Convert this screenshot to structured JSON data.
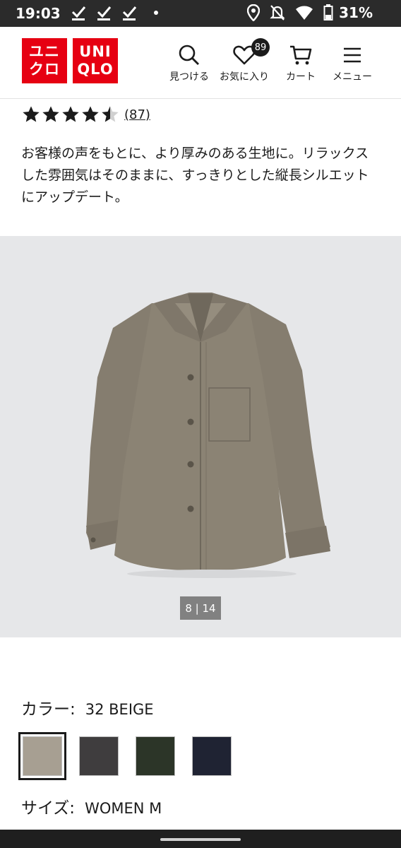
{
  "status_bar": {
    "time": "19:03",
    "battery": "31%",
    "icons": [
      "check-icon",
      "check-icon",
      "check-icon",
      "dot-icon",
      "location-icon",
      "mute-icon",
      "wifi-icon",
      "battery-icon"
    ]
  },
  "header": {
    "logo": {
      "left_top": "ユニ",
      "left_bottom": "クロ",
      "right_top": "UNI",
      "right_bottom": "QLO"
    },
    "nav": {
      "search": "見つける",
      "favorites": "お気に入り",
      "favorites_badge": "89",
      "cart": "カート",
      "menu": "メニュー"
    }
  },
  "product": {
    "rating": 4.5,
    "review_count": "(87)",
    "description": "お客様の声をもとに、より厚みのある生地に。リラックスした雰囲気はそのままに、すっきりとした縦長シルエットにアップデート。",
    "image_counter": "8 | 14",
    "color_label": "カラー:",
    "color_value": "32 BEIGE",
    "swatches": [
      {
        "name": "beige",
        "color": "#a79f92",
        "selected": true
      },
      {
        "name": "dark-gray",
        "color": "#3f3d3e",
        "selected": false
      },
      {
        "name": "olive",
        "color": "#2c3528",
        "selected": false
      },
      {
        "name": "navy",
        "color": "#1f2333",
        "selected": false
      }
    ],
    "size_label": "サイズ:",
    "size_value": "WOMEN M"
  },
  "colors": {
    "brand_red": "#e60012",
    "shirt": "#8b8374",
    "image_bg": "#e6e7e9"
  }
}
